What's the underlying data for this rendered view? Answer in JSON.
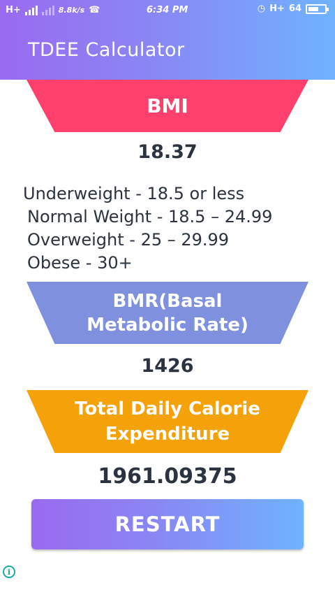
{
  "status_bar": {
    "network_left": "H+",
    "data_speed": "8.8k/s",
    "time": "6:34 PM",
    "network_right": "H+",
    "battery": "64",
    "icons": [
      "signal-icon",
      "whatsapp-icon",
      "alarm-icon",
      "battery-icon"
    ]
  },
  "app_bar": {
    "title": "TDEE Calculator"
  },
  "bmi": {
    "label": "BMI",
    "value": "18.37",
    "ranges": [
      "Underweight - 18.5 or less",
      "Normal Weight - 18.5 – 24.99",
      "Overweight - 25 – 29.99",
      "Obese - 30+"
    ]
  },
  "bmr": {
    "label_line1": "BMR(Basal",
    "label_line2": "Metabolic Rate)",
    "value": "1426"
  },
  "tdee": {
    "label_line1": "Total Daily Calorie",
    "label_line2": "Expenditure",
    "value": "1961.09375"
  },
  "restart_button": {
    "label": "RESTART"
  },
  "colors": {
    "bmi_accent": "#ff3f6c",
    "bmr_accent": "#7f91de",
    "tdee_accent": "#f5a10a",
    "gradient_start": "#9a6af0",
    "gradient_end": "#6fb3ff",
    "value_text": "#2b3340"
  }
}
